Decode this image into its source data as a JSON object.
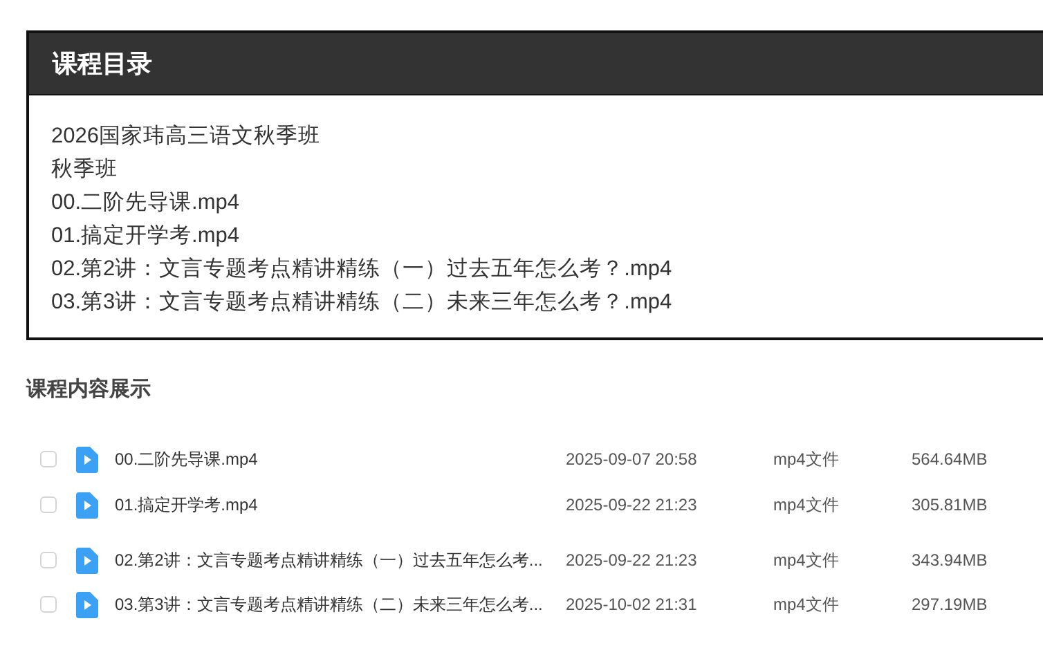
{
  "catalog": {
    "title": "课程目录",
    "lines": [
      "2026国家玮高三语文秋季班",
      "秋季班",
      "00.二阶先导课.mp4",
      "01.搞定开学考.mp4",
      "02.第2讲：文言专题考点精讲精练（一）过去五年怎么考？.mp4",
      "03.第3讲：文言专题考点精讲精练（二）未来三年怎么考？.mp4"
    ]
  },
  "contents": {
    "heading": "课程内容展示",
    "files": [
      {
        "checked": false,
        "name": "00.二阶先导课.mp4",
        "date": "2025-09-07 20:58",
        "type": "mp4文件",
        "size": "564.64MB"
      },
      {
        "checked": false,
        "name": "01.搞定开学考.mp4",
        "date": "2025-09-22 21:23",
        "type": "mp4文件",
        "size": "305.81MB"
      },
      {
        "checked": false,
        "name": "02.第2讲：文言专题考点精讲精练（一）过去五年怎么考...",
        "date": "2025-09-22 21:23",
        "type": "mp4文件",
        "size": "343.94MB"
      },
      {
        "checked": false,
        "name": "03.第3讲：文言专题考点精讲精练（二）未来三年怎么考...",
        "date": "2025-10-02 21:31",
        "type": "mp4文件",
        "size": "297.19MB"
      }
    ]
  }
}
